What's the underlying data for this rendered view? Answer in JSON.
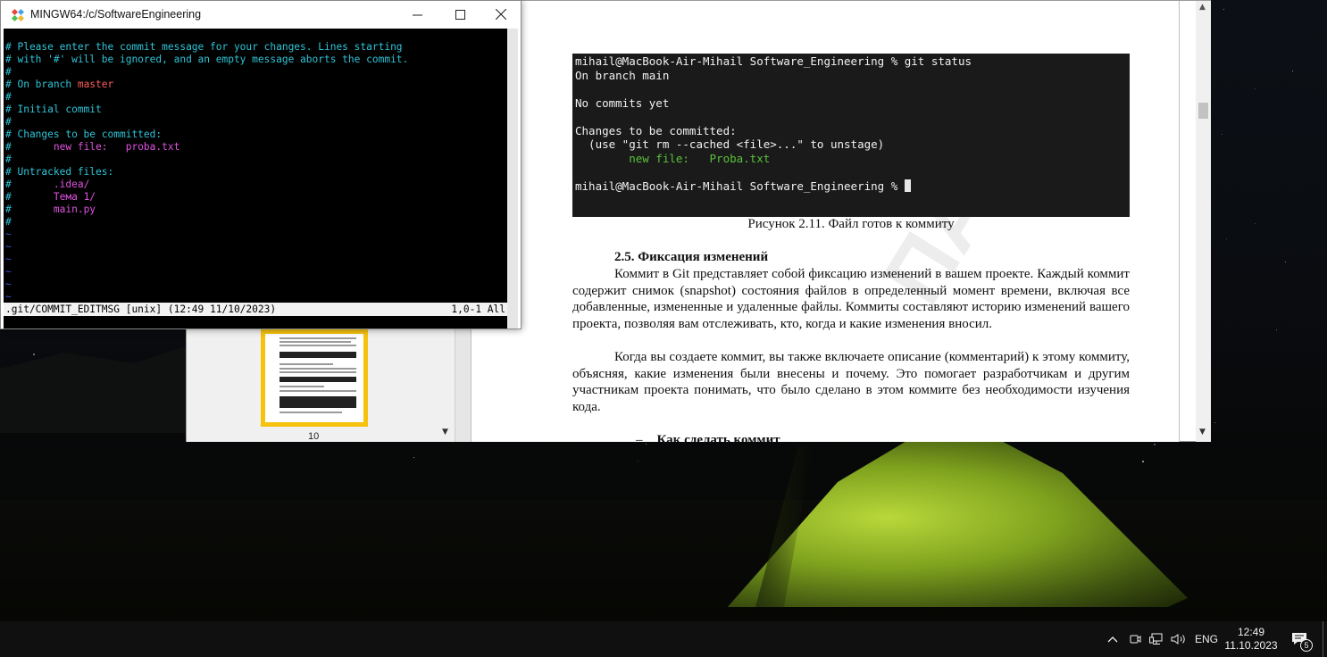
{
  "git_window": {
    "title": "MINGW64:/c/SoftwareEngineering",
    "lines": [
      [
        {
          "t": "# Please enter the commit message for your changes. Lines starting",
          "c": "cyan"
        }
      ],
      [
        {
          "t": "# with '#' will be ignored, and an empty message aborts the commit.",
          "c": "cyan"
        }
      ],
      [
        {
          "t": "#",
          "c": "cyan"
        }
      ],
      [
        {
          "t": "# On branch ",
          "c": "cyan"
        },
        {
          "t": "master",
          "c": "red"
        }
      ],
      [
        {
          "t": "#",
          "c": "cyan"
        }
      ],
      [
        {
          "t": "# Initial commit",
          "c": "cyan"
        }
      ],
      [
        {
          "t": "#",
          "c": "cyan"
        }
      ],
      [
        {
          "t": "# Changes to be committed:",
          "c": "cyan"
        }
      ],
      [
        {
          "t": "#       ",
          "c": "cyan"
        },
        {
          "t": "new file:   proba.txt",
          "c": "magenta"
        }
      ],
      [
        {
          "t": "#",
          "c": "cyan"
        }
      ],
      [
        {
          "t": "# Untracked files:",
          "c": "cyan"
        }
      ],
      [
        {
          "t": "#       ",
          "c": "cyan"
        },
        {
          "t": ".idea/",
          "c": "magenta"
        }
      ],
      [
        {
          "t": "#       ",
          "c": "cyan"
        },
        {
          "t": "Тема 1/",
          "c": "magenta"
        }
      ],
      [
        {
          "t": "#       ",
          "c": "cyan"
        },
        {
          "t": "main.py",
          "c": "magenta"
        }
      ],
      [
        {
          "t": "#",
          "c": "cyan"
        }
      ],
      [
        {
          "t": "~",
          "c": "tilde"
        }
      ],
      [
        {
          "t": "~",
          "c": "tilde"
        }
      ],
      [
        {
          "t": "~",
          "c": "tilde"
        }
      ],
      [
        {
          "t": "~",
          "c": "tilde"
        }
      ],
      [
        {
          "t": "~",
          "c": "tilde"
        }
      ],
      [
        {
          "t": "~",
          "c": "tilde"
        }
      ],
      [
        {
          "t": "~",
          "c": "tilde"
        }
      ]
    ],
    "status_left": ".git/COMMIT_EDITMSG [unix] (12:49 11/10/2023)",
    "status_right": "1,0-1 All"
  },
  "document": {
    "thumbnail_page_number": "10",
    "terminal_figure": {
      "lines": [
        {
          "t": "mihail@MacBook-Air-Mihail Software_Engineering % git status",
          "c": "white"
        },
        {
          "t": "On branch main",
          "c": "white"
        },
        {
          "t": "",
          "c": "white"
        },
        {
          "t": "No commits yet",
          "c": "white"
        },
        {
          "t": "",
          "c": "white"
        },
        {
          "t": "Changes to be committed:",
          "c": "white"
        },
        {
          "t": "  (use \"git rm --cached <file>...\" to unstage)",
          "c": "white"
        },
        {
          "t": "        new file:   Proba.txt",
          "c": "green"
        },
        {
          "t": "",
          "c": "white"
        },
        {
          "t": "mihail@MacBook-Air-Mihail Software_Engineering % ",
          "c": "white",
          "cursor": true
        }
      ]
    },
    "figure_caption": "Рисунок 2.11. Файл готов к коммиту",
    "section_heading": "2.5. Фиксация изменений",
    "paragraph_1": "Коммит в Git представляет собой фиксацию изменений в вашем проекте. Каждый коммит содержит снимок (snapshot) состояния файлов в определенный момент времени, включая все добавленные, измененные и удаленные файлы. Коммиты составляют историю изменений вашего проекта, позволяя вам отслеживать, кто, когда и какие изменения вносил.",
    "paragraph_2": "Когда вы создаете коммит, вы также включаете описание (комментарий) к этому коммиту, объясняя, какие изменения были внесены и почему. Это помогает разработчикам и другим участникам проекта понимать, что было сделано в этом коммите без необходимости изучения кода.",
    "subheading_dash": "–",
    "subheading": "Как сделать коммит",
    "watermark": "ПАВ"
  },
  "taskbar": {
    "language": "ENG",
    "time": "12:49",
    "date": "11.10.2023",
    "notification_count": "5"
  }
}
